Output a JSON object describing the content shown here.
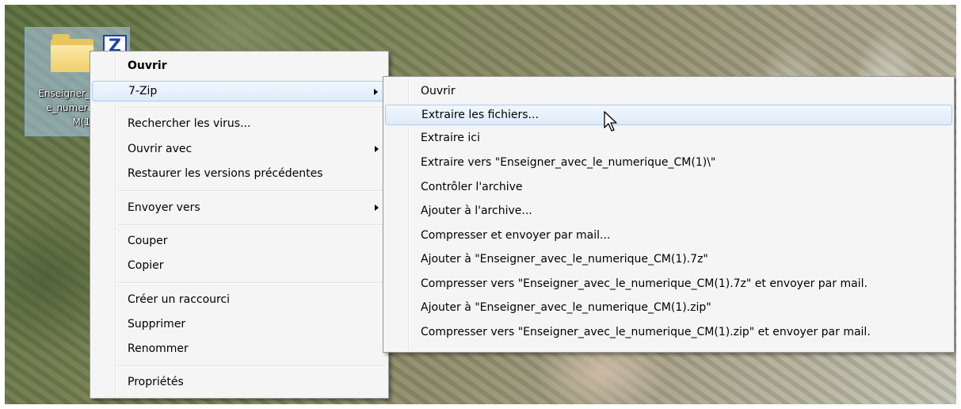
{
  "desktop_icon": {
    "badge": "Z",
    "label_lines": [
      "Enseigner_",
      "e_numeri",
      "M(1"
    ]
  },
  "context_menu": {
    "items": [
      {
        "label": "Ouvrir",
        "bold": true
      },
      {
        "label": "7-Zip",
        "has_submenu": true,
        "highlighted": true
      },
      {
        "label": "Rechercher les virus..."
      },
      {
        "label": "Ouvrir avec",
        "has_submenu": true
      },
      {
        "label": "Restaurer les versions précédentes"
      },
      {
        "label": "Envoyer vers",
        "has_submenu": true
      },
      {
        "label": "Couper"
      },
      {
        "label": "Copier"
      },
      {
        "label": "Créer un raccourci"
      },
      {
        "label": "Supprimer"
      },
      {
        "label": "Renommer"
      },
      {
        "label": "Propriétés"
      }
    ]
  },
  "zip_submenu": {
    "items": [
      {
        "label": "Ouvrir"
      },
      {
        "label": "Extraire les fichiers...",
        "highlighted": true
      },
      {
        "label": "Extraire ici"
      },
      {
        "label": "Extraire vers \"Enseigner_avec_le_numerique_CM(1)\\\""
      },
      {
        "label": "Contrôler l'archive"
      },
      {
        "label": "Ajouter à l'archive..."
      },
      {
        "label": "Compresser et envoyer par mail..."
      },
      {
        "label": "Ajouter à \"Enseigner_avec_le_numerique_CM(1).7z\""
      },
      {
        "label": "Compresser vers \"Enseigner_avec_le_numerique_CM(1).7z\" et envoyer par mail."
      },
      {
        "label": "Ajouter à \"Enseigner_avec_le_numerique_CM(1).zip\""
      },
      {
        "label": "Compresser vers \"Enseigner_avec_le_numerique_CM(1).zip\" et envoyer par mail."
      }
    ]
  },
  "icons": {
    "cursor": "arrow-pointer-icon",
    "folder": "zip-folder-icon",
    "submenu": "chevron-right-icon"
  }
}
